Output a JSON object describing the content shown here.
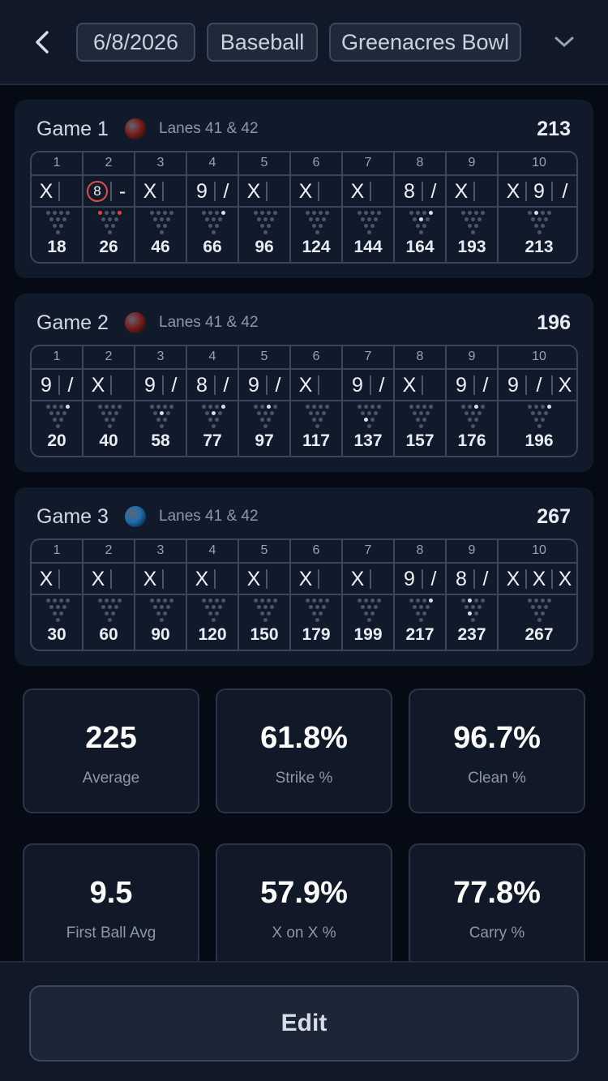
{
  "header": {
    "date": "6/8/2026",
    "event": "Baseball",
    "venue": "Greenacres Bowl"
  },
  "games": [
    {
      "title": "Game 1",
      "lanes": "Lanes 41 & 42",
      "total": "213",
      "ball_color": "#7a1d1d",
      "frames": [
        {
          "n": "1",
          "r": [
            "X"
          ],
          "score": "18",
          "std": []
        },
        {
          "n": "2",
          "r": [
            "8",
            "-"
          ],
          "split": true,
          "score": "26",
          "std": [],
          "splitpins": [
            7,
            10
          ]
        },
        {
          "n": "3",
          "r": [
            "X"
          ],
          "score": "46",
          "std": []
        },
        {
          "n": "4",
          "r": [
            "9",
            "/"
          ],
          "score": "66",
          "std": [
            10
          ]
        },
        {
          "n": "5",
          "r": [
            "X"
          ],
          "score": "96",
          "std": []
        },
        {
          "n": "6",
          "r": [
            "X"
          ],
          "score": "124",
          "std": []
        },
        {
          "n": "7",
          "r": [
            "X"
          ],
          "score": "144",
          "std": []
        },
        {
          "n": "8",
          "r": [
            "8",
            "/"
          ],
          "score": "164",
          "std": [
            5,
            10
          ]
        },
        {
          "n": "9",
          "r": [
            "X"
          ],
          "score": "193",
          "std": []
        },
        {
          "n": "10",
          "r": [
            "X",
            "9",
            "/"
          ],
          "score": "213",
          "std": [
            8
          ]
        }
      ]
    },
    {
      "title": "Game 2",
      "lanes": "Lanes 41 & 42",
      "total": "196",
      "ball_color": "#7a1d1d",
      "frames": [
        {
          "n": "1",
          "r": [
            "9",
            "/"
          ],
          "score": "20",
          "std": [
            10
          ]
        },
        {
          "n": "2",
          "r": [
            "X"
          ],
          "score": "40",
          "std": []
        },
        {
          "n": "3",
          "r": [
            "9",
            "/"
          ],
          "score": "58",
          "std": [
            5
          ]
        },
        {
          "n": "4",
          "r": [
            "8",
            "/"
          ],
          "score": "77",
          "std": [
            5,
            10
          ]
        },
        {
          "n": "5",
          "r": [
            "9",
            "/"
          ],
          "score": "97",
          "std": [
            9
          ]
        },
        {
          "n": "6",
          "r": [
            "X"
          ],
          "score": "117",
          "std": []
        },
        {
          "n": "7",
          "r": [
            "9",
            "/"
          ],
          "score": "137",
          "std": [
            2
          ]
        },
        {
          "n": "8",
          "r": [
            "X"
          ],
          "score": "157",
          "std": []
        },
        {
          "n": "9",
          "r": [
            "9",
            "/"
          ],
          "score": "176",
          "std": [
            9
          ]
        },
        {
          "n": "10",
          "r": [
            "9",
            "/",
            "X"
          ],
          "score": "196",
          "std": [
            10
          ]
        }
      ]
    },
    {
      "title": "Game 3",
      "lanes": "Lanes 41 & 42",
      "total": "267",
      "ball_color": "#1d6fb0",
      "frames": [
        {
          "n": "1",
          "r": [
            "X"
          ],
          "score": "30",
          "std": []
        },
        {
          "n": "2",
          "r": [
            "X"
          ],
          "score": "60",
          "std": []
        },
        {
          "n": "3",
          "r": [
            "X"
          ],
          "score": "90",
          "std": []
        },
        {
          "n": "4",
          "r": [
            "X"
          ],
          "score": "120",
          "std": []
        },
        {
          "n": "5",
          "r": [
            "X"
          ],
          "score": "150",
          "std": []
        },
        {
          "n": "6",
          "r": [
            "X"
          ],
          "score": "179",
          "std": []
        },
        {
          "n": "7",
          "r": [
            "X"
          ],
          "score": "199",
          "std": []
        },
        {
          "n": "8",
          "r": [
            "9",
            "/"
          ],
          "score": "217",
          "std": [
            10
          ]
        },
        {
          "n": "9",
          "r": [
            "8",
            "/"
          ],
          "score": "237",
          "std": [
            8,
            2
          ]
        },
        {
          "n": "10",
          "r": [
            "X",
            "X",
            "X"
          ],
          "score": "267",
          "std": []
        }
      ]
    }
  ],
  "stats": [
    {
      "value": "225",
      "label": "Average"
    },
    {
      "value": "61.8%",
      "label": "Strike %"
    },
    {
      "value": "96.7%",
      "label": "Clean %"
    },
    {
      "value": "9.5",
      "label": "First Ball Avg"
    },
    {
      "value": "57.9%",
      "label": "X on X %"
    },
    {
      "value": "77.8%",
      "label": "Carry %"
    }
  ],
  "footer": {
    "edit_label": "Edit"
  }
}
